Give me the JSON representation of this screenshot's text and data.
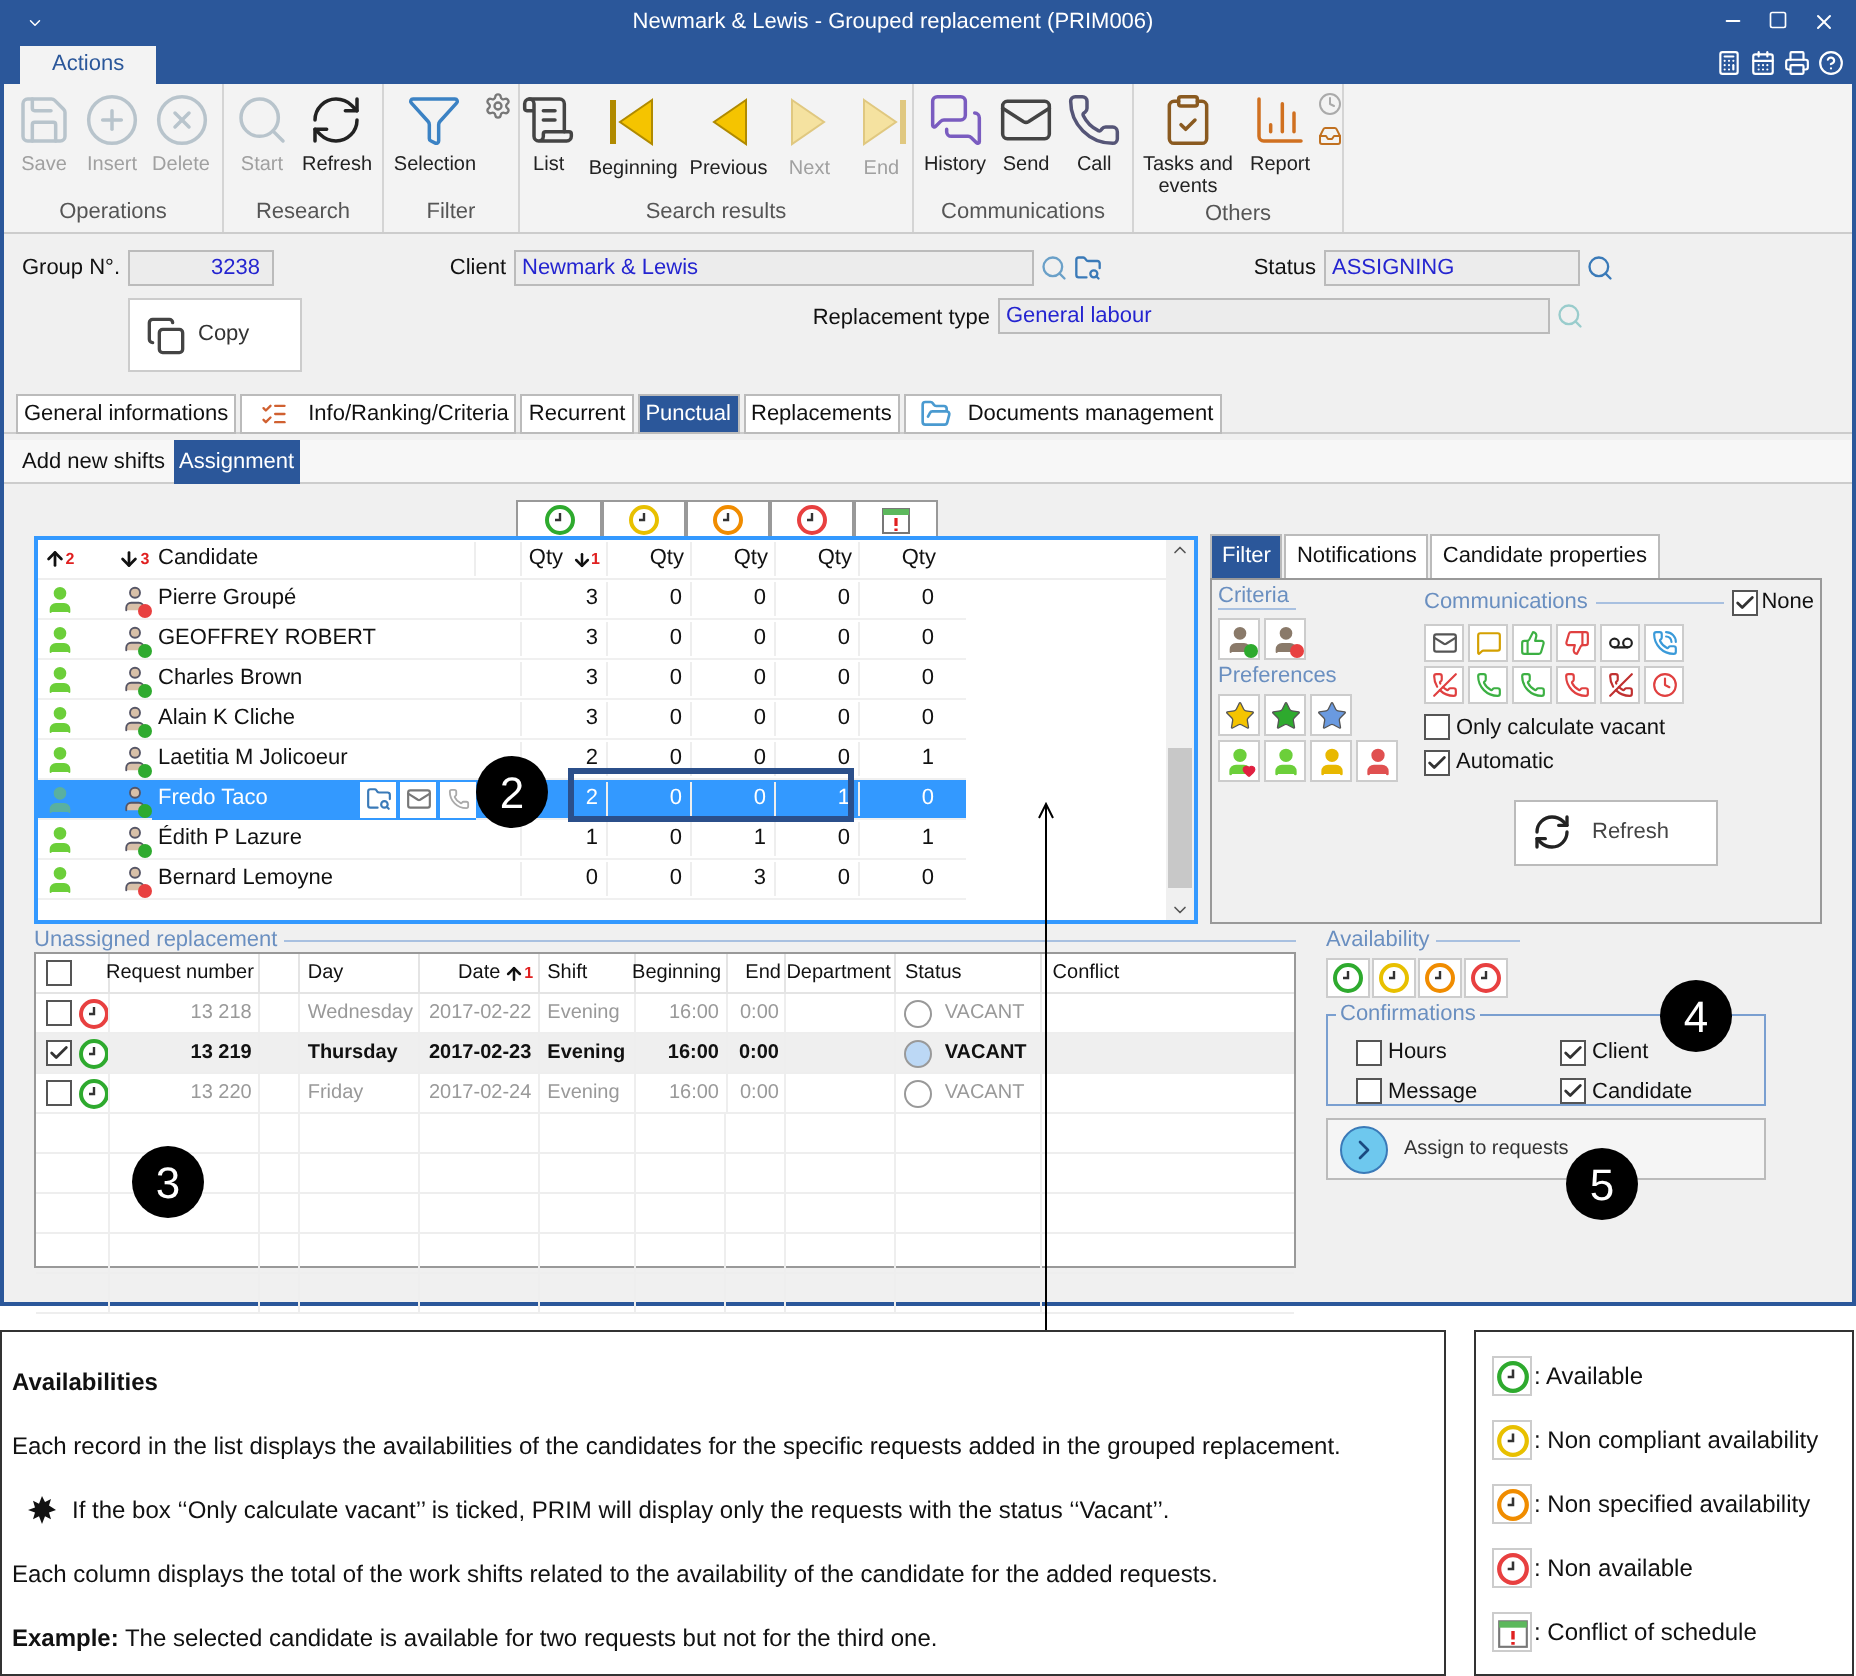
{
  "window": {
    "title": "Newmark & Lewis - Grouped replacement (PRIM006)"
  },
  "ribbon": {
    "tabs": [
      {
        "label": "Actions",
        "selected": true
      }
    ],
    "groups": [
      {
        "label": "Operations",
        "buttons": [
          {
            "label": "Save",
            "disabled": true
          },
          {
            "label": "Insert",
            "disabled": true
          },
          {
            "label": "Delete",
            "disabled": true
          }
        ]
      },
      {
        "label": "Research",
        "buttons": [
          {
            "label": "Start",
            "disabled": true
          },
          {
            "label": "Refresh",
            "disabled": false
          }
        ]
      },
      {
        "label": "Filter",
        "buttons": [
          {
            "label": "Selection",
            "disabled": false
          }
        ]
      },
      {
        "label": "Search results",
        "buttons": [
          {
            "label": "List",
            "disabled": false
          },
          {
            "label": "Beginning",
            "disabled": false
          },
          {
            "label": "Previous",
            "disabled": false
          },
          {
            "label": "Next",
            "disabled": true
          },
          {
            "label": "End",
            "disabled": true
          }
        ]
      },
      {
        "label": "Communications",
        "buttons": [
          {
            "label": "History",
            "disabled": false
          },
          {
            "label": "Send",
            "disabled": false
          },
          {
            "label": "Call",
            "disabled": false
          }
        ]
      },
      {
        "label": "Others",
        "buttons": [
          {
            "label": "Tasks and events",
            "disabled": false
          },
          {
            "label": "Report",
            "disabled": false
          }
        ]
      }
    ]
  },
  "form": {
    "group_no": {
      "label": "Group N°.",
      "value": "3238"
    },
    "client": {
      "label": "Client",
      "value": "Newmark & Lewis"
    },
    "status": {
      "label": "Status",
      "value": "ASSIGNING"
    },
    "replacement_type": {
      "label": "Replacement type",
      "value": "General labour"
    },
    "copy_button": "Copy"
  },
  "tabs": [
    {
      "label": "General informations",
      "selected": false
    },
    {
      "label": "Info/Ranking/Criteria",
      "selected": false
    },
    {
      "label": "Recurrent",
      "selected": false
    },
    {
      "label": "Punctual",
      "selected": true
    },
    {
      "label": "Replacements",
      "selected": false
    },
    {
      "label": "Documents management",
      "selected": false
    }
  ],
  "subtabs": [
    {
      "label": "Add new shifts",
      "selected": false
    },
    {
      "label": "Assignment",
      "selected": true
    }
  ],
  "candidates": {
    "sort_marks": [
      {
        "ascending": true,
        "order": "2"
      },
      {
        "ascending": false,
        "order": "3"
      }
    ],
    "name_header": "Candidate",
    "availability_columns": [
      {
        "kind": "clock",
        "color": "#2eaa2e"
      },
      {
        "kind": "clock",
        "color": "#e8c000"
      },
      {
        "kind": "clock",
        "color": "#f08c00"
      },
      {
        "kind": "clock",
        "color": "#e84040"
      },
      {
        "kind": "calendar"
      }
    ],
    "qty_headers": [
      {
        "label": "Qty",
        "ascending": false,
        "order": "1"
      },
      {
        "label": "Qty"
      },
      {
        "label": "Qty"
      },
      {
        "label": "Qty"
      },
      {
        "label": "Qty"
      }
    ],
    "rows": [
      {
        "name": "Pierre Groupé",
        "color": "#e84040",
        "selected": false,
        "qty": [
          "3",
          "0",
          "0",
          "0",
          "0"
        ]
      },
      {
        "name": "GEOFFREY ROBERT",
        "color": "#2eaa2e",
        "selected": false,
        "qty": [
          "3",
          "0",
          "0",
          "0",
          "0"
        ]
      },
      {
        "name": "Charles Brown",
        "color": "#2eaa2e",
        "selected": false,
        "qty": [
          "3",
          "0",
          "0",
          "0",
          "0"
        ]
      },
      {
        "name": "Alain K Cliche",
        "color": "#2eaa2e",
        "selected": false,
        "qty": [
          "3",
          "0",
          "0",
          "0",
          "0"
        ]
      },
      {
        "name": "Laetitia M Jolicoeur",
        "color": "#2eaa2e",
        "selected": false,
        "qty": [
          "2",
          "0",
          "0",
          "0",
          "1"
        ]
      },
      {
        "name": "Fredo Taco",
        "color": "#2eaa2e",
        "selected": true,
        "qty": [
          "2",
          "0",
          "0",
          "1",
          "0"
        ]
      },
      {
        "name": "Édith P Lazure",
        "color": "#2eaa2e",
        "selected": false,
        "qty": [
          "1",
          "0",
          "1",
          "0",
          "1"
        ]
      },
      {
        "name": "Bernard  Lemoyne",
        "color": "#e84040",
        "selected": false,
        "qty": [
          "0",
          "0",
          "3",
          "0",
          "0"
        ]
      }
    ]
  },
  "filter_panel": {
    "tabs": [
      {
        "label": "Filter",
        "selected": true
      },
      {
        "label": "Notifications",
        "selected": false
      },
      {
        "label": "Candidate properties",
        "selected": false
      }
    ],
    "criteria_label": "Criteria",
    "preferences_label": "Preferences",
    "communications_label": "Communications",
    "none": {
      "label": "None",
      "checked": true
    },
    "options": [
      {
        "label": "Only calculate vacant",
        "checked": false
      },
      {
        "label": "Automatic",
        "checked": true
      }
    ],
    "refresh_button": "Refresh"
  },
  "unassigned": {
    "title": "Unassigned replacement",
    "all_checked": false,
    "columns": [
      "Request number",
      "",
      "Day",
      "Date",
      "Shift",
      "Beginning",
      "End",
      "Department",
      "Status",
      "Conflict"
    ],
    "date_sort_order": "1",
    "rows": [
      {
        "checked": false,
        "selected": false,
        "color": "#e84040",
        "request_number": "13 218",
        "day": "Wednesday",
        "date": "2017-02-22",
        "shift": "Evening",
        "beginning": "16:00",
        "end": "0:00",
        "status": "VACANT"
      },
      {
        "checked": true,
        "selected": true,
        "color": "#2eaa2e",
        "request_number": "13 219",
        "day": "Thursday",
        "date": "2017-02-23",
        "shift": "Evening",
        "beginning": "16:00",
        "end": "0:00",
        "status": "VACANT"
      },
      {
        "checked": false,
        "selected": false,
        "color": "#2eaa2e",
        "request_number": "13 220",
        "day": "Friday",
        "date": "2017-02-24",
        "shift": "Evening",
        "beginning": "16:00",
        "end": "0:00",
        "status": "VACANT"
      }
    ]
  },
  "availability": {
    "label": "Availability",
    "filters": [
      {
        "color": "#2eaa2e"
      },
      {
        "color": "#e8c000"
      },
      {
        "color": "#f08c00"
      },
      {
        "color": "#e84040"
      }
    ]
  },
  "confirmations": {
    "label": "Confirmations",
    "options": [
      {
        "label": "Hours",
        "checked": false
      },
      {
        "label": "Client",
        "checked": true
      },
      {
        "label": "Message",
        "checked": false
      },
      {
        "label": "Candidate",
        "checked": true
      }
    ]
  },
  "assign_button": "Assign to requests",
  "callouts": [
    "2",
    "3",
    "4",
    "5"
  ],
  "note": {
    "title": "Availabilities",
    "paragraphs": [
      {
        "kind": "text",
        "text": "Each record in the list displays the availabilities of the candidates for the specific requests added in the grouped replacement."
      },
      {
        "kind": "burst",
        "text": "If the box ‘‘Only calculate vacant’’ is ticked, PRIM will display only the requests with the status ‘‘Vacant’’."
      },
      {
        "kind": "text",
        "text": "Each column displays the total of the work shifts related to the availability of the candidate for the added requests."
      },
      {
        "kind": "text",
        "text": "**Example:** The selected candidate is available for two requests but not for the third one."
      }
    ]
  },
  "legend": [
    {
      "kind": "clock",
      "color": "#2eaa2e",
      "label": ": Available"
    },
    {
      "kind": "clock",
      "color": "#e8c000",
      "label": ": Non compliant availability"
    },
    {
      "kind": "clock",
      "color": "#f08c00",
      "label": ": Non specified availability"
    },
    {
      "kind": "clock",
      "color": "#e84040",
      "label": ": Non available"
    },
    {
      "kind": "calendar",
      "label": ": Conflict of schedule"
    }
  ]
}
